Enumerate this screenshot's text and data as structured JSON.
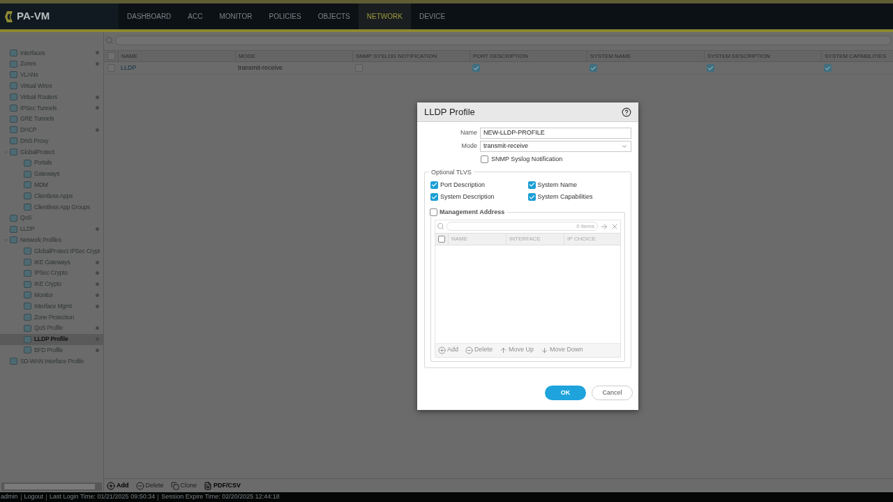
{
  "header": {
    "logo": "PA-VM",
    "tabs": [
      {
        "label": "DASHBOARD",
        "selected": false
      },
      {
        "label": "ACC",
        "selected": false
      },
      {
        "label": "MONITOR",
        "selected": false
      },
      {
        "label": "POLICIES",
        "selected": false
      },
      {
        "label": "OBJECTS",
        "selected": false
      },
      {
        "label": "NETWORK",
        "selected": true
      },
      {
        "label": "DEVICE",
        "selected": false
      }
    ]
  },
  "sidebar": {
    "items": [
      {
        "label": "Interfaces",
        "marked": true,
        "selected": false
      },
      {
        "label": "Zones",
        "marked": true,
        "selected": false
      },
      {
        "label": "VLANs",
        "marked": false,
        "selected": false
      },
      {
        "label": "Virtual Wires",
        "marked": false,
        "selected": false
      },
      {
        "label": "Virtual Routers",
        "marked": true,
        "selected": false
      },
      {
        "label": "IPSec Tunnels",
        "marked": true,
        "selected": false
      },
      {
        "label": "GRE Tunnels",
        "marked": false,
        "selected": false
      },
      {
        "label": "DHCP",
        "marked": true,
        "selected": false
      },
      {
        "label": "DNS Proxy",
        "marked": false,
        "selected": false
      },
      {
        "label": "GlobalProtect",
        "marked": false,
        "selected": false,
        "expanded": true,
        "children": [
          {
            "label": "Portals",
            "marked": false,
            "selected": false
          },
          {
            "label": "Gateways",
            "marked": false,
            "selected": false
          },
          {
            "label": "MDM",
            "marked": false,
            "selected": false
          },
          {
            "label": "Clientless Apps",
            "marked": false,
            "selected": false
          },
          {
            "label": "Clientless App Groups",
            "marked": false,
            "selected": false
          }
        ]
      },
      {
        "label": "QoS",
        "marked": false,
        "selected": false
      },
      {
        "label": "LLDP",
        "marked": true,
        "selected": false
      },
      {
        "label": "Network Profiles",
        "marked": false,
        "selected": false,
        "expanded": true,
        "children": [
          {
            "label": "GlobalProtect IPSec Crypt",
            "marked": false,
            "selected": false
          },
          {
            "label": "IKE Gateways",
            "marked": true,
            "selected": false
          },
          {
            "label": "IPSec Crypto",
            "marked": true,
            "selected": false
          },
          {
            "label": "IKE Crypto",
            "marked": true,
            "selected": false
          },
          {
            "label": "Monitor",
            "marked": true,
            "selected": false
          },
          {
            "label": "Interface Mgmt",
            "marked": true,
            "selected": false
          },
          {
            "label": "Zone Protection",
            "marked": false,
            "selected": false
          },
          {
            "label": "QoS Profile",
            "marked": true,
            "selected": false
          },
          {
            "label": "LLDP Profile",
            "marked": true,
            "selected": true
          },
          {
            "label": "BFD Profile",
            "marked": true,
            "selected": false
          }
        ]
      },
      {
        "label": "SD-WAN Interface Profile",
        "marked": false,
        "selected": false
      }
    ]
  },
  "table": {
    "select_all": {
      "checked": false
    },
    "columns": [
      "NAME",
      "MODE",
      "SNMP SYSLOG NOTIFICATION",
      "PORT DESCRIPTION",
      "SYSTEM NAME",
      "SYSTEM DESCRIPTION",
      "SYSTEM CAPABILITIES"
    ],
    "rows": [
      {
        "selected": false,
        "name": "LLDP",
        "mode": "transmit-receive",
        "flags": [
          {
            "checked": false
          },
          {
            "checked": true
          },
          {
            "checked": true
          },
          {
            "checked": true
          },
          {
            "checked": true
          }
        ]
      }
    ]
  },
  "toolbar": [
    {
      "label": "Add",
      "disabled": false
    },
    {
      "label": "Delete",
      "disabled": true
    },
    {
      "label": "Clone",
      "disabled": true
    },
    {
      "label": "PDF/CSV",
      "disabled": false
    }
  ],
  "dialog": {
    "title": "LLDP Profile",
    "fields": [
      {
        "label": "Name",
        "kind": "text",
        "value": "NEW-LLDP-PROFILE"
      },
      {
        "label": "Mode",
        "kind": "select",
        "value": "transmit-receive"
      }
    ],
    "snmp": {
      "label": "SNMP Syslog Notification",
      "checked": false
    },
    "tlvs": {
      "legend": "Optional TLVS",
      "options": [
        {
          "label": "Port Description",
          "checked": true
        },
        {
          "label": "System Name",
          "checked": true
        },
        {
          "label": "System Description",
          "checked": true
        },
        {
          "label": "System Capabilities",
          "checked": true
        }
      ],
      "management": {
        "label": "Management Address",
        "checked": false,
        "select_all": {
          "checked": false
        },
        "count": "0 items",
        "columns": [
          "NAME",
          "INTERFACE",
          "IP CHOICE"
        ],
        "actions": [
          {
            "label": "Add",
            "disabled": true
          },
          {
            "label": "Delete",
            "disabled": true
          },
          {
            "label": "Move Up",
            "disabled": true
          },
          {
            "label": "Move Down",
            "disabled": true
          }
        ]
      }
    },
    "buttons": [
      {
        "label": "OK",
        "kind": "primary"
      },
      {
        "label": "Cancel",
        "kind": "secondary"
      }
    ]
  },
  "status_bar": [
    "admin",
    "Logout",
    "Last Login Time: 01/21/2025 09:50:34",
    "Session Expire Time: 02/20/2025 12:44:18"
  ]
}
